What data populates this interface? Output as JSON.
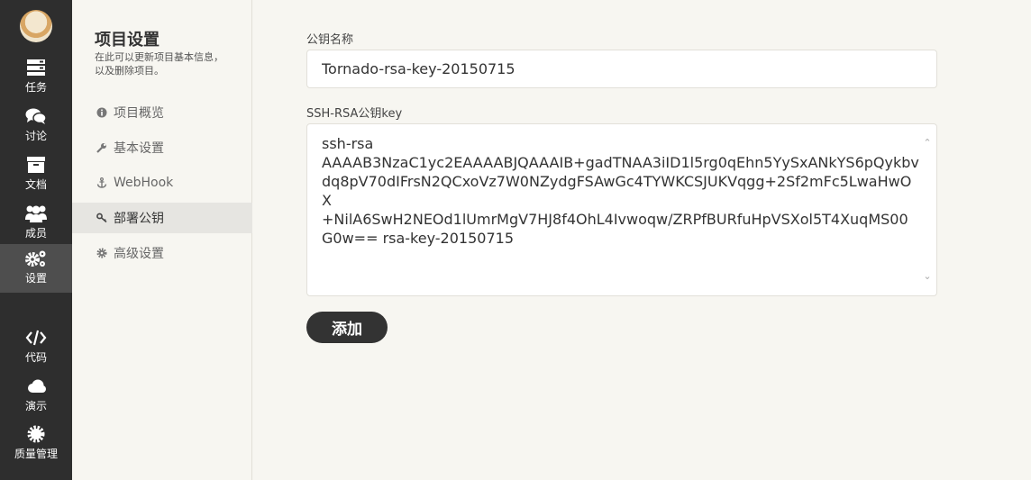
{
  "rail": {
    "items": [
      {
        "label": "任务",
        "icon": "tasks-icon"
      },
      {
        "label": "讨论",
        "icon": "chat-bubbles-icon"
      },
      {
        "label": "文档",
        "icon": "archive-box-icon"
      },
      {
        "label": "成员",
        "icon": "users-icon"
      },
      {
        "label": "设置",
        "icon": "gears-icon"
      },
      {
        "label": "代码",
        "icon": "code-icon"
      },
      {
        "label": "演示",
        "icon": "cloud-icon"
      },
      {
        "label": "质量管理",
        "icon": "badge-icon"
      }
    ],
    "active": "设置"
  },
  "menu": {
    "title": "项目设置",
    "description": "在此可以更新项目基本信息，以及删除项目。",
    "items": [
      {
        "label": "项目概览",
        "icon": "info-icon"
      },
      {
        "label": "基本设置",
        "icon": "wrench-icon"
      },
      {
        "label": "WebHook",
        "icon": "anchor-icon"
      },
      {
        "label": "部署公钥",
        "icon": "key-icon"
      },
      {
        "label": "高级设置",
        "icon": "gear-icon"
      }
    ],
    "active": "部署公钥"
  },
  "form": {
    "name_label": "公钥名称",
    "name_value": "Tornado-rsa-key-20150715",
    "key_label": "SSH-RSA公钥key",
    "key_lines": [
      "ssh-rsa",
      "AAAAB3NzaC1yc2EAAAABJQAAAIB+gadTNAA3iID1l5rg0qEhn5YySxANkYS6pQykbv",
      "dq8pV70dIFrsN2QCxoVz7W0NZydgFSAwGc4TYWKCSJUKVqgg+2Sf2mFc5LwaHwOX",
      "+NilA6SwH2NEOd1lUmrMgV7HJ8f4OhL4Ivwoqw/ZRPfBURfuHpVSXol5T4XuqMS00",
      "G0w== rsa-key-20150715"
    ],
    "submit_label": "添加"
  },
  "colors": {
    "rail_bg": "#2e2e2e",
    "rail_active": "#4e4e4e",
    "page_bg": "#f7f6f1",
    "button_bg": "#333333"
  }
}
